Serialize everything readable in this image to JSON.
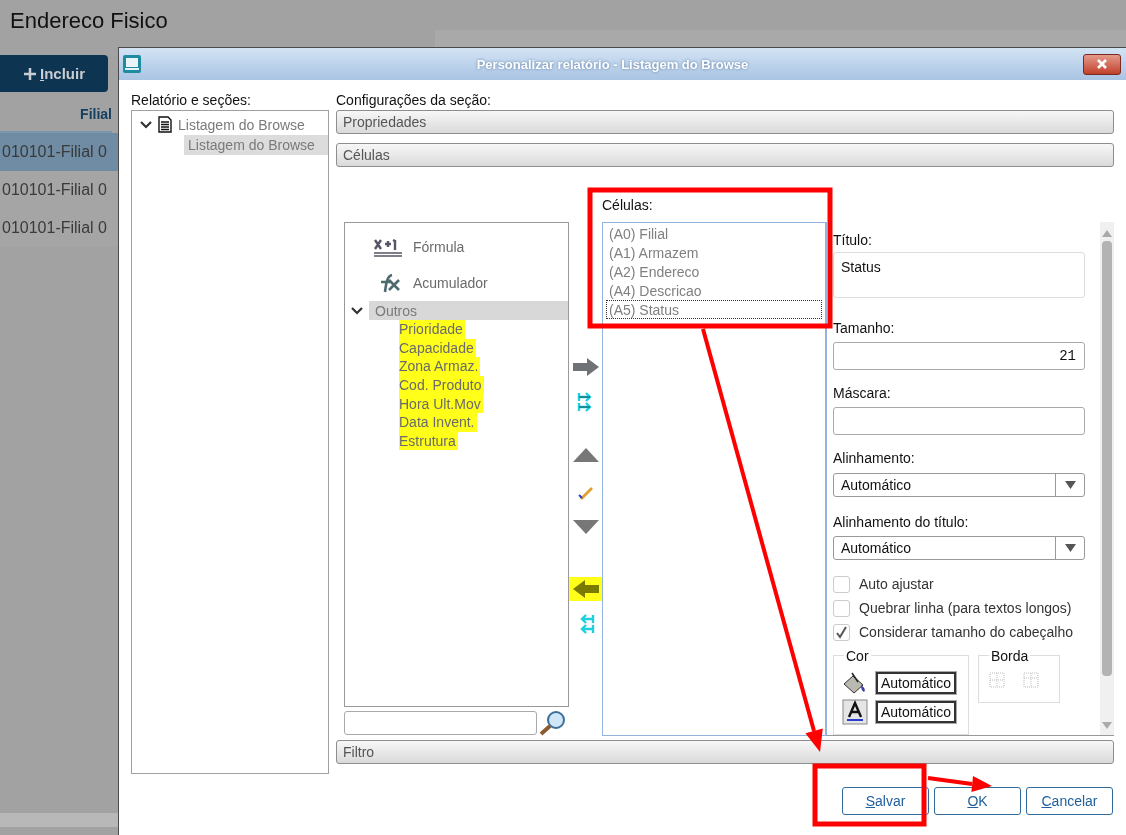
{
  "background_page": {
    "title": "Endereco Fisico",
    "add_button": "Incluir",
    "column_header": "Filial",
    "rows": [
      {
        "cell": "010101-Filial 0",
        "selected": true
      },
      {
        "cell": "010101-Filial 0",
        "selected": false
      },
      {
        "cell": "010101-Filial 0",
        "selected": false
      }
    ]
  },
  "dialog": {
    "title": "Personalizar relatório - Listagem do Browse",
    "report_label": "Relatório e seções:",
    "tree": [
      {
        "label": "Listagem do Browse",
        "expanded": true,
        "children": [
          {
            "label": "Listagem do Browse",
            "selected": true
          }
        ]
      }
    ],
    "section_label": "Configurações da seção:",
    "sections": [
      {
        "label": "Propriedades"
      },
      {
        "label": "Células"
      }
    ],
    "fields": [
      {
        "kind": "formula",
        "label": "Fórmula"
      },
      {
        "kind": "accumulator",
        "label": "Acumulador"
      },
      {
        "kind": "group",
        "label": "Outros",
        "expanded": true,
        "children": [
          {
            "label": "Prioridade",
            "highlighted": true
          },
          {
            "label": "Capacidade",
            "highlighted": true
          },
          {
            "label": "Zona Armaz.",
            "highlighted": true
          },
          {
            "label": "Cod. Produto",
            "highlighted": true
          },
          {
            "label": "Hora Ult.Mov",
            "highlighted": true
          },
          {
            "label": "Data Invent.",
            "highlighted": true
          },
          {
            "label": "Estrutura",
            "highlighted": true
          }
        ]
      }
    ],
    "move_buttons": [
      {
        "kind": "add",
        "highlighted": false
      },
      {
        "kind": "add_all",
        "highlighted": false
      },
      {
        "kind": "up",
        "highlighted": false
      },
      {
        "kind": "edit",
        "highlighted": false
      },
      {
        "kind": "down",
        "highlighted": false
      },
      {
        "kind": "remove",
        "highlighted": true
      },
      {
        "kind": "remove_all",
        "highlighted": false
      }
    ],
    "cells_label": "Células:",
    "cells": [
      {
        "label": "(A0) Filial",
        "selected": false
      },
      {
        "label": "(A1) Armazem",
        "selected": false
      },
      {
        "label": "(A2) Endereco",
        "selected": false
      },
      {
        "label": "(A4) Descricao",
        "selected": false
      },
      {
        "label": "(A5) Status",
        "selected": true
      }
    ],
    "properties": {
      "title_label": "Título:",
      "title_value": "Status",
      "size_label": "Tamanho:",
      "size_value": "21",
      "mask_label": "Máscara:",
      "align_label": "Alinhamento:",
      "align_value": "Automático",
      "title_align_label": "Alinhamento do título:",
      "title_align_value": "Automático",
      "checkboxes": [
        {
          "label": "Auto ajustar",
          "checked": false
        },
        {
          "label": "Quebrar linha (para textos longos)",
          "checked": false
        },
        {
          "label": "Considerar tamanho do cabeçalho",
          "checked": true
        }
      ],
      "color_group": "Cor",
      "background_color": "Automático",
      "font_color": "Automático",
      "border_group": "Borda"
    },
    "filter_section": "Filtro",
    "buttons": [
      {
        "label": "Salvar"
      },
      {
        "label": "OK"
      },
      {
        "label": "Cancelar"
      }
    ]
  }
}
